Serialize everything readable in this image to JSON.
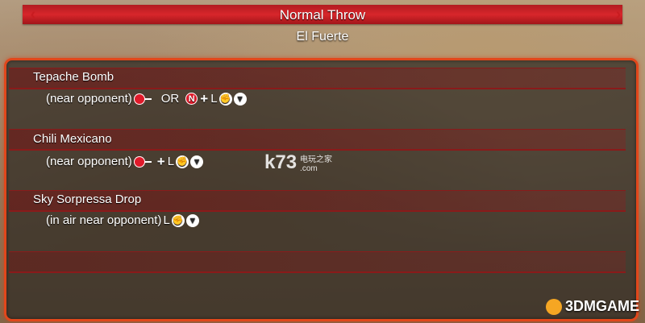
{
  "header": {
    "title": "Normal Throw",
    "subtitle": "El Fuerte",
    "left_arrow": "‹",
    "right_arrow": "›"
  },
  "moves": [
    {
      "name": "Tepache Bomb",
      "condition": "(near opponent)",
      "alt_word": "OR",
      "button_n": "N",
      "punch": "L"
    },
    {
      "name": "Chili Mexicano",
      "condition": "(near opponent)",
      "punch": "L"
    },
    {
      "name": "Sky Sorpressa Drop",
      "condition": "(in air near opponent)",
      "punch": "L"
    }
  ],
  "watermarks": {
    "k73": "k73",
    "k73_sub": "电玩之家",
    "k73_sub2": ".com",
    "threedm": "3DMGAME"
  },
  "colors": {
    "accent_red": "#d8262b",
    "border_orange": "#e1471b"
  }
}
